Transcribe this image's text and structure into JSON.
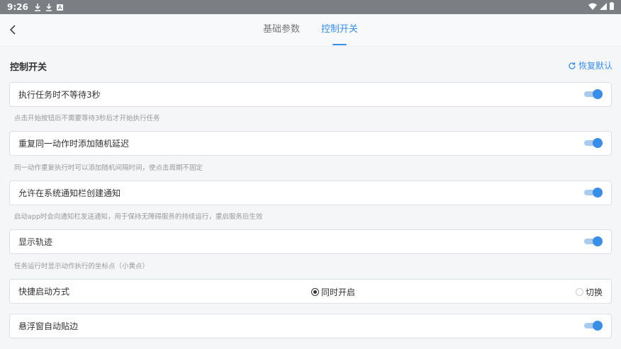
{
  "status_bar": {
    "time": "9:26",
    "left_icons": [
      "download-icon",
      "download-icon",
      "text-app-icon"
    ],
    "right_icons": [
      "wifi-icon",
      "signal-icon",
      "battery-icon"
    ]
  },
  "header": {
    "back_icon": "chevron-left-icon",
    "tabs": [
      {
        "label": "基础参数",
        "active": false
      },
      {
        "label": "控制开关",
        "active": true
      }
    ]
  },
  "section": {
    "title": "控制开关",
    "reset_label": "恢复默认",
    "reset_icon": "refresh-icon"
  },
  "settings": [
    {
      "label": "执行任务时不等待3秒",
      "enabled": true,
      "description": "点击开始按钮后不需要等待3秒后才开始执行任务"
    },
    {
      "label": "重复同一动作时添加随机延迟",
      "enabled": true,
      "description": "同一动作重复执行时可以添加随机间隔时间，使点击周期不固定"
    },
    {
      "label": "允许在系统通知栏创建通知",
      "enabled": true,
      "description": "启动app时会向通知栏发送通知，用于保持无障碍服务的持续运行，重启服务后生效"
    },
    {
      "label": "显示轨迹",
      "enabled": true,
      "description": "任务运行时显示动作执行的坐标点（小黄点）"
    }
  ],
  "quick_start": {
    "label": "快捷启动方式",
    "options": [
      {
        "label": "同时开启",
        "selected": true
      },
      {
        "label": "切换",
        "selected": false
      }
    ]
  },
  "float_snap": {
    "label": "悬浮窗自动贴边",
    "enabled": true
  },
  "colors": {
    "accent": "#3a8ee6",
    "toggle_track": "#aacbf0",
    "status_bar": "#7b7e83",
    "background": "#f5f6f8"
  }
}
